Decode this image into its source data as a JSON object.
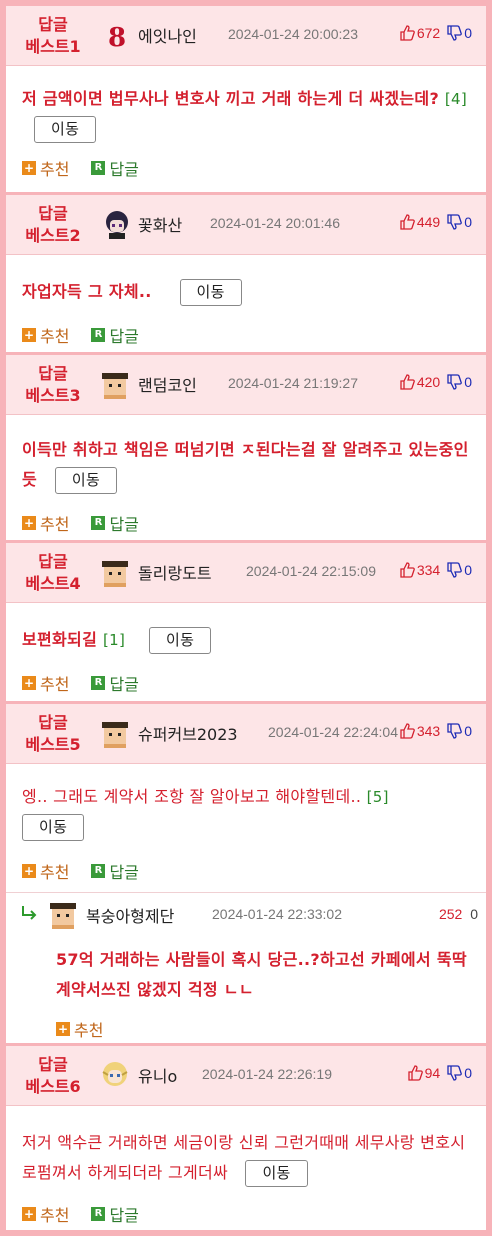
{
  "labels": {
    "recommend": "추천",
    "reply": "답글",
    "move": "이동"
  },
  "colors": {
    "accent": "#d4202e",
    "header_bg": "#fde5e7",
    "border": "#f7b3b9",
    "down_vote": "#1d2bb5",
    "count": "#2a8a2a"
  },
  "comments": [
    {
      "badge": "답글\n베스트1",
      "nick": "에잇나인",
      "avatar_icon": "eight-logo-icon",
      "date": "2024-01-24 20:00:23",
      "up": "672",
      "down": "0",
      "text": "저 금액이면 법무사나 변호사 끼고 거래 하는게 더 싸겠는데?",
      "count": "[4]"
    },
    {
      "badge": "답글\n베스트2",
      "nick": "꽃화산",
      "avatar_icon": "anime-avatar-icon",
      "date": "2024-01-24 20:01:46",
      "up": "449",
      "down": "0",
      "text": "자업자득 그 자체..",
      "count": ""
    },
    {
      "badge": "답글\n베스트3",
      "nick": "랜덤코인",
      "avatar_icon": "pixel-avatar-icon",
      "date": "2024-01-24 21:19:27",
      "up": "420",
      "down": "0",
      "text": "이득만 취하고 책임은 떠넘기면 ㅈ된다는걸 잘 알려주고 있는중인듯",
      "count": ""
    },
    {
      "badge": "답글\n베스트4",
      "nick": "돌리랑도트",
      "avatar_icon": "pixel-avatar-icon",
      "date": "2024-01-24 22:15:09",
      "up": "334",
      "down": "0",
      "text": "보편화되길",
      "count": "[1]"
    },
    {
      "badge": "답글\n베스트5",
      "nick": "슈퍼커브2023",
      "avatar_icon": "pixel-avatar-icon",
      "date": "2024-01-24 22:24:04",
      "up": "343",
      "down": "0",
      "text": "엥.. 그래도 계약서 조항 잘 알아보고 해야할텐데..",
      "count": "[5]"
    },
    {
      "badge": "답글\n베스트6",
      "nick": "유니o",
      "avatar_icon": "blonde-avatar-icon",
      "date": "2024-01-24 22:26:19",
      "up": "94",
      "down": "0",
      "text": "저거 액수큰 거래하면 세금이랑 신뢰 그런거때매 세무사랑 변호시로펌껴서 하게되더라 그게더싸",
      "count": ""
    }
  ],
  "reply": {
    "nick": "복숭아형제단",
    "date": "2024-01-24 22:33:02",
    "up": "252",
    "down": "0",
    "text": "57억 거래하는 사람들이 혹시 당근..?하고선 카페에서 뚝딱 계약서쓰진 않겠지 걱정 ㄴㄴ"
  }
}
